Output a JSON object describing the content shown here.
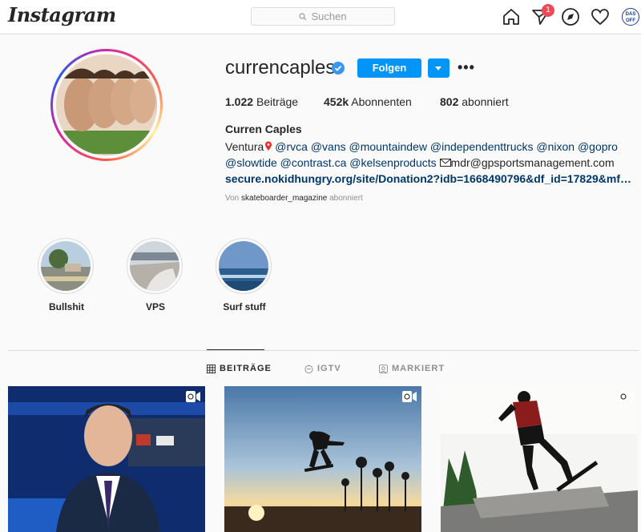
{
  "nav": {
    "logo": "Instagram",
    "search_placeholder": "Suchen",
    "notification_count": "1",
    "avatar_text": "DAS OFF"
  },
  "profile": {
    "username": "currencaples",
    "follow_label": "Folgen",
    "stats": [
      {
        "count": "1.022",
        "label": "Beiträge"
      },
      {
        "count": "452k",
        "label": "Abonnenten"
      },
      {
        "count": "802",
        "label": "abonniert"
      }
    ],
    "fullname": "Curren Caples",
    "bio_line1_prefix": "Ventura",
    "bio_line1_mentions": "@rvca @vans @mountaindew @independenttrucks @nixon @gopro",
    "bio_line2_mentions": "@slowtide @contrast.ca @kelsenproducts",
    "bio_line2_email": "mdr@gpsportsmanagement.com",
    "bio_link": "secure.nokidhungry.org/site/Donation2?idb=1668490796&df_id=17829&mfc_...",
    "followed_by_prefix": "Von",
    "followed_by_user": "skateboarder_magazine",
    "followed_by_suffix": "abonniert"
  },
  "highlights": [
    {
      "label": "Bullshit"
    },
    {
      "label": "VPS"
    },
    {
      "label": "Surf stuff"
    }
  ],
  "tabs": [
    {
      "label": "BEITRÄGE",
      "active": true
    },
    {
      "label": "IGTV",
      "active": false
    },
    {
      "label": "MARKIERT",
      "active": false
    }
  ],
  "colors": {
    "accent": "#0095f6",
    "badge": "#ed4956",
    "link": "#00376b"
  }
}
